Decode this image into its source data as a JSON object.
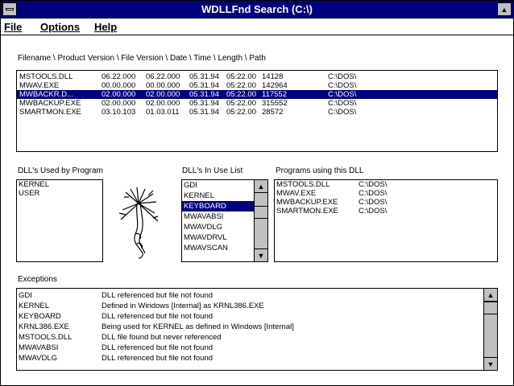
{
  "window": {
    "title": "WDLLFnd Search (C:\\)"
  },
  "menu": {
    "file": "File",
    "options": "Options",
    "help": "Help"
  },
  "columns_header": "Filename \\ Product Version \\ File Version \\ Date \\ Time \\ Length \\ Path",
  "files": [
    {
      "name": "MSTOOLS.DLL",
      "pver": "06.22.000",
      "fver": "06.22.000",
      "date": "05.31.94",
      "time": "05:22.00",
      "len": "14128",
      "path": "C:\\DOS\\"
    },
    {
      "name": "MWAV.EXE",
      "pver": "00.00.000",
      "fver": "00.00.000",
      "date": "05.31.94",
      "time": "05:22.00",
      "len": "142964",
      "path": "C:\\DOS\\"
    },
    {
      "name": "MWBACKR.D...",
      "pver": "02.00.000",
      "fver": "02.00.000",
      "date": "05.31.94",
      "time": "05:22.00",
      "len": "117552",
      "path": "C:\\DOS\\"
    },
    {
      "name": "MWBACKUP.EXE",
      "pver": "02.00.000",
      "fver": "02.00.000",
      "date": "05.31.94",
      "time": "05:22.00",
      "len": "315552",
      "path": "C:\\DOS\\"
    },
    {
      "name": "SMARTMON.EXE",
      "pver": "03.10.103",
      "fver": "01.03.011",
      "date": "05.31.94",
      "time": "05:22.00",
      "len": "28572",
      "path": "C:\\DOS\\"
    }
  ],
  "dlls_used": {
    "label": "DLL's Used by Program",
    "items": [
      "KERNEL",
      "USER"
    ]
  },
  "dlls_in_use": {
    "label": "DLL's In Use List",
    "items": [
      "GDI",
      "KERNEL",
      "KEYBOARD",
      "MWAVABSI",
      "MWAVDLG",
      "MWAVDRVL",
      "MWAVSCAN"
    ]
  },
  "programs_using": {
    "label": "Programs using this DLL",
    "items": [
      {
        "name": "MSTOOLS.DLL",
        "path": "C:\\DOS\\"
      },
      {
        "name": "MWAV.EXE",
        "path": "C:\\DOS\\"
      },
      {
        "name": "MWBACKUP.EXE",
        "path": "C:\\DOS\\"
      },
      {
        "name": "SMARTMON.EXE",
        "path": "C:\\DOS\\"
      }
    ]
  },
  "exceptions": {
    "label": "Exceptions",
    "items": [
      {
        "name": "GDI",
        "msg": "DLL referenced but file not found"
      },
      {
        "name": "KERNEL",
        "msg": "Defined in Windows [Internal] as KRNL386.EXE"
      },
      {
        "name": "KEYBOARD",
        "msg": "DLL referenced but file not found"
      },
      {
        "name": "KRNL386.EXE",
        "msg": "Being used for KERNEL as defined in Windows [Internal]"
      },
      {
        "name": "MSTOOLS.DLL",
        "msg": "DLL file found but never referenced"
      },
      {
        "name": "MWAVABSI",
        "msg": "DLL referenced but file not found"
      },
      {
        "name": "MWAVDLG",
        "msg": "DLL referenced but file not found"
      }
    ]
  },
  "colors": {
    "titlebar": "#00007f",
    "selection": "#00007f",
    "chrome": "#c0c0c0"
  },
  "icons": {
    "sysmenu": "system-menu-icon",
    "maximize": "maximize-arrow-icon",
    "logo": "tree-root-icon"
  }
}
